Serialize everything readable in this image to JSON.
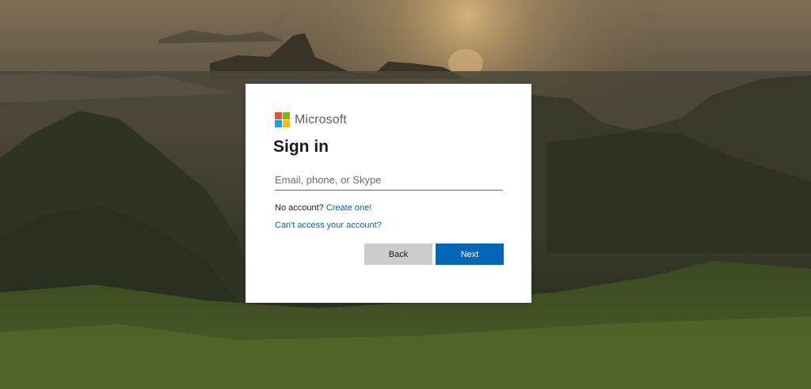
{
  "brand": {
    "name": "Microsoft",
    "logo_colors": [
      "#f25022",
      "#7fba00",
      "#00a4ef",
      "#ffb900"
    ]
  },
  "signin": {
    "title": "Sign in",
    "email_placeholder": "Email, phone, or Skype",
    "email_value": "",
    "no_account_text": "No account?",
    "create_link": "Create one!",
    "cant_access_link": "Can't access your account?",
    "back_label": "Back",
    "next_label": "Next"
  },
  "colors": {
    "accent": "#0067b8",
    "back_button": "#cccccc",
    "card": "#ffffff"
  }
}
